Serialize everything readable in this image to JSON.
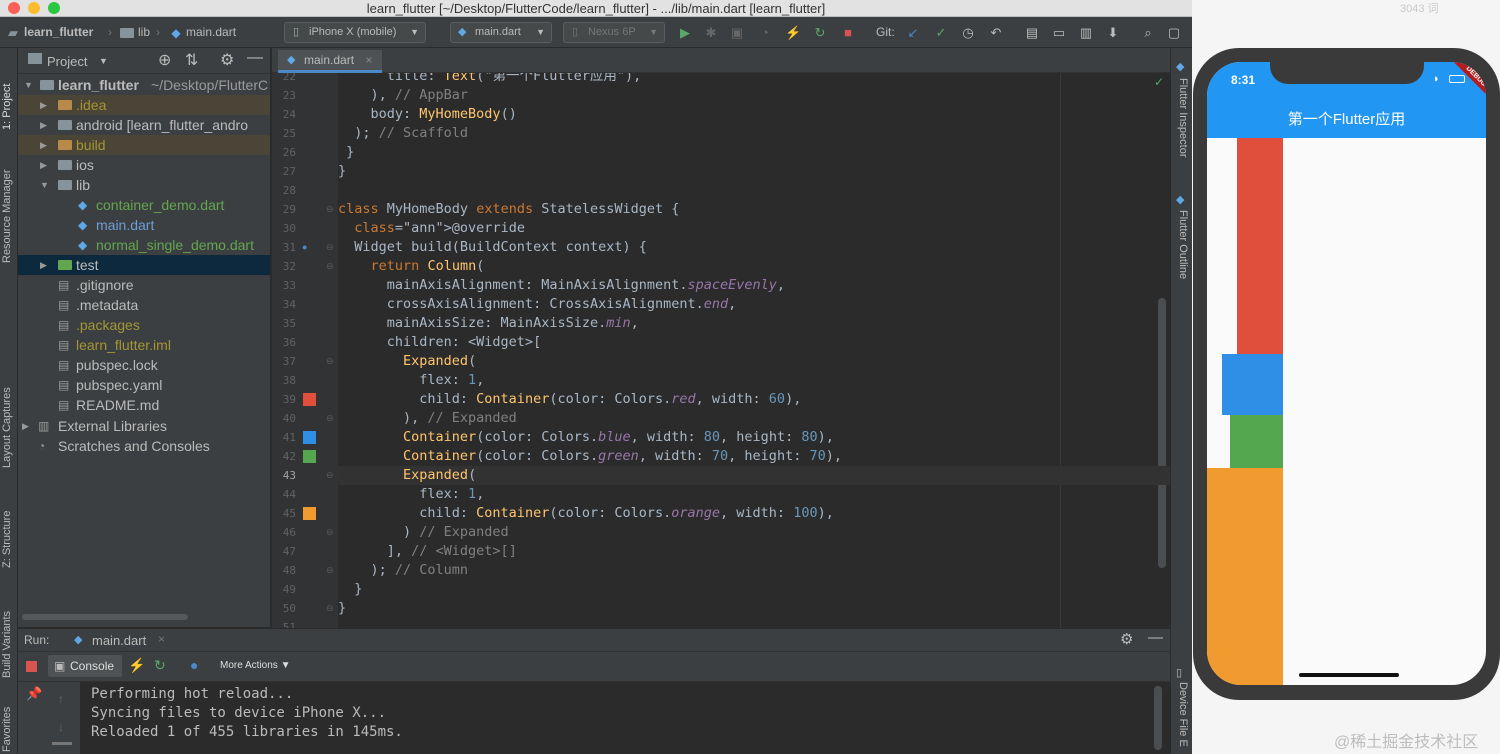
{
  "window": {
    "title": "learn_flutter [~/Desktop/FlutterCode/learn_flutter] - .../lib/main.dart [learn_flutter]"
  },
  "toolbar": {
    "breadcrumb": [
      "learn_flutter",
      "lib",
      "main.dart"
    ],
    "device": "iPhone X (mobile)",
    "run_config": "main.dart",
    "emulator": "Nexus 6P",
    "git_label": "Git:"
  },
  "left_strip": {
    "tabs": [
      "1: Project",
      "Resource Manager",
      "Layout Captures",
      "Z: Structure",
      "Build Variants",
      "Favorites"
    ]
  },
  "right_strip": {
    "tabs": [
      "Flutter Inspector",
      "Flutter Outline",
      "Device File E"
    ]
  },
  "project": {
    "header": "Project",
    "tree": [
      {
        "label": "learn_flutter",
        "extra": "~/Desktop/FlutterC",
        "level": 0,
        "expanded": true,
        "kind": "root"
      },
      {
        "label": ".idea",
        "level": 1,
        "expanded": false,
        "kind": "excluded-folder"
      },
      {
        "label": "android [learn_flutter_andro",
        "level": 1,
        "expanded": false,
        "kind": "folder"
      },
      {
        "label": "build",
        "level": 1,
        "expanded": false,
        "kind": "excluded-folder"
      },
      {
        "label": "ios",
        "level": 1,
        "expanded": false,
        "kind": "folder"
      },
      {
        "label": "lib",
        "level": 1,
        "expanded": true,
        "kind": "folder"
      },
      {
        "label": "container_demo.dart",
        "level": 2,
        "kind": "dart-new"
      },
      {
        "label": "main.dart",
        "level": 2,
        "kind": "dart"
      },
      {
        "label": "normal_single_demo.dart",
        "level": 2,
        "kind": "dart-new"
      },
      {
        "label": "test",
        "level": 1,
        "expanded": false,
        "kind": "folder"
      },
      {
        "label": ".gitignore",
        "level": 1,
        "kind": "file"
      },
      {
        "label": ".metadata",
        "level": 1,
        "kind": "file"
      },
      {
        "label": ".packages",
        "level": 1,
        "kind": "file-ignored"
      },
      {
        "label": "learn_flutter.iml",
        "level": 1,
        "kind": "file-ignored"
      },
      {
        "label": "pubspec.lock",
        "level": 1,
        "kind": "file"
      },
      {
        "label": "pubspec.yaml",
        "level": 1,
        "kind": "file"
      },
      {
        "label": "README.md",
        "level": 1,
        "kind": "file"
      },
      {
        "label": "External Libraries",
        "level": 0,
        "expanded": false,
        "kind": "library"
      },
      {
        "label": "Scratches and Consoles",
        "level": 0,
        "kind": "scratch"
      }
    ]
  },
  "editor": {
    "tab": "main.dart",
    "line_numbers": [
      "22",
      "23",
      "24",
      "25",
      "26",
      "27",
      "28",
      "29",
      "30",
      "31",
      "32",
      "33",
      "34",
      "35",
      "36",
      "37",
      "38",
      "39",
      "40",
      "41",
      "42",
      "43",
      "44",
      "45",
      "46",
      "47",
      "48",
      "49",
      "50",
      "51"
    ],
    "current_line": "43",
    "lines": [
      "      title: Text(\"第一个Flutter应用\"),",
      "    ), // AppBar",
      "    body: MyHomeBody()",
      "  ); // Scaffold",
      " }",
      "}",
      "",
      "class MyHomeBody extends StatelessWidget {",
      "  @override",
      "  Widget build(BuildContext context) {",
      "    return Column(",
      "      mainAxisAlignment: MainAxisAlignment.spaceEvenly,",
      "      crossAxisAlignment: CrossAxisAlignment.end,",
      "      mainAxisSize: MainAxisSize.min,",
      "      children: <Widget>[",
      "        Expanded(",
      "          flex: 1,",
      "          child: Container(color: Colors.red, width: 60),",
      "        ), // Expanded",
      "        Container(color: Colors.blue, width: 80, height: 80),",
      "        Container(color: Colors.green, width: 70, height: 70),",
      "        Expanded(",
      "          flex: 1,",
      "          child: Container(color: Colors.orange, width: 100),",
      "        ) // Expanded",
      "      ], // <Widget>[]",
      "    ); // Column",
      "  }",
      "}",
      ""
    ],
    "gutter_swatches": [
      {
        "line": "39",
        "color": "#e04e3c"
      },
      {
        "line": "41",
        "color": "#2f8ee6"
      },
      {
        "line": "42",
        "color": "#54a74e"
      },
      {
        "line": "45",
        "color": "#f09a30"
      }
    ]
  },
  "run": {
    "label": "Run:",
    "tab": "main.dart",
    "console_tab": "Console",
    "more_actions": "More Actions",
    "output": [
      "Performing hot reload...",
      "Syncing files to device iPhone X...",
      "Reloaded 1 of 455 libraries in 145ms."
    ]
  },
  "phone": {
    "time": "8:31",
    "appbar_title": "第一个Flutter应用",
    "debug_banner": "DEBUG",
    "colors": {
      "appbar": "#2196f3",
      "red": "#e04e3c",
      "blue": "#2f8ee6",
      "green": "#54a74e",
      "orange": "#f09a30"
    },
    "column_children": [
      {
        "color": "red",
        "width_dp": 60,
        "flex": 1
      },
      {
        "color": "blue",
        "width_dp": 80,
        "height_dp": 80
      },
      {
        "color": "green",
        "width_dp": 70,
        "height_dp": 70
      },
      {
        "color": "orange",
        "width_dp": 100,
        "flex": 1
      }
    ]
  },
  "background": {
    "word_count": "3043 词",
    "watermark": "@稀土掘金技术社区"
  }
}
